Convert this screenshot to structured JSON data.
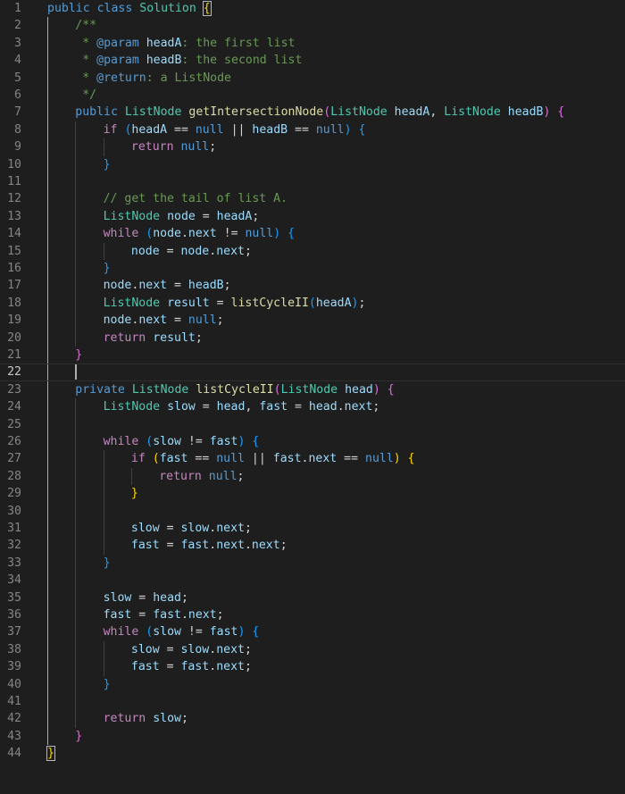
{
  "editor": {
    "active_line": 22,
    "colors": {
      "background": "#1e1e1e",
      "keyword": "#569cd6",
      "control": "#c586c0",
      "type": "#4ec9b0",
      "function": "#dcdcaa",
      "variable": "#9cdcfe",
      "comment": "#6a9955",
      "text": "#d4d4d4",
      "line_number": "#858585",
      "scope_guide": "#c9b53a"
    },
    "lines": [
      {
        "n": "1",
        "indent": 0,
        "tokens": [
          [
            "kw",
            "public"
          ],
          [
            "p",
            " "
          ],
          [
            "kw",
            "class"
          ],
          [
            "p",
            " "
          ],
          [
            "type",
            "Solution"
          ],
          [
            "p",
            " "
          ],
          [
            "b1",
            "{"
          ]
        ]
      },
      {
        "n": "2",
        "indent": 1,
        "tokens": [
          [
            "cm",
            "/**"
          ]
        ]
      },
      {
        "n": "3",
        "indent": 1,
        "tokens": [
          [
            "cm",
            " * "
          ],
          [
            "kw",
            "@param"
          ],
          [
            "cm",
            " "
          ],
          [
            "var",
            "headA"
          ],
          [
            "cm",
            ": the first list"
          ]
        ]
      },
      {
        "n": "4",
        "indent": 1,
        "tokens": [
          [
            "cm",
            " * "
          ],
          [
            "kw",
            "@param"
          ],
          [
            "cm",
            " "
          ],
          [
            "var",
            "headB"
          ],
          [
            "cm",
            ": the second list"
          ]
        ]
      },
      {
        "n": "5",
        "indent": 1,
        "tokens": [
          [
            "cm",
            " * "
          ],
          [
            "kw",
            "@return"
          ],
          [
            "cm",
            ": a ListNode"
          ]
        ]
      },
      {
        "n": "6",
        "indent": 1,
        "tokens": [
          [
            "cm",
            " */"
          ]
        ]
      },
      {
        "n": "7",
        "indent": 1,
        "tokens": [
          [
            "kw",
            "public"
          ],
          [
            "p",
            " "
          ],
          [
            "type",
            "ListNode"
          ],
          [
            "p",
            " "
          ],
          [
            "fn",
            "getIntersectionNode"
          ],
          [
            "b2",
            "("
          ],
          [
            "type",
            "ListNode"
          ],
          [
            "p",
            " "
          ],
          [
            "var",
            "headA"
          ],
          [
            "p",
            ", "
          ],
          [
            "type",
            "ListNode"
          ],
          [
            "p",
            " "
          ],
          [
            "var",
            "headB"
          ],
          [
            "b2",
            ")"
          ],
          [
            "p",
            " "
          ],
          [
            "b2",
            "{"
          ]
        ]
      },
      {
        "n": "8",
        "indent": 2,
        "tokens": [
          [
            "ctrl",
            "if"
          ],
          [
            "p",
            " "
          ],
          [
            "b3",
            "("
          ],
          [
            "var",
            "headA"
          ],
          [
            "p",
            " == "
          ],
          [
            "null",
            "null"
          ],
          [
            "p",
            " || "
          ],
          [
            "var",
            "headB"
          ],
          [
            "p",
            " == "
          ],
          [
            "null",
            "null"
          ],
          [
            "b3",
            ")"
          ],
          [
            "p",
            " "
          ],
          [
            "b3",
            "{"
          ]
        ]
      },
      {
        "n": "9",
        "indent": 3,
        "tokens": [
          [
            "ctrl",
            "return"
          ],
          [
            "p",
            " "
          ],
          [
            "null",
            "null"
          ],
          [
            "p",
            ";"
          ]
        ]
      },
      {
        "n": "10",
        "indent": 2,
        "tokens": [
          [
            "b3",
            "}"
          ]
        ]
      },
      {
        "n": "11",
        "indent": 2,
        "tokens": []
      },
      {
        "n": "12",
        "indent": 2,
        "tokens": [
          [
            "cm",
            "// get the tail of list A."
          ]
        ]
      },
      {
        "n": "13",
        "indent": 2,
        "tokens": [
          [
            "type",
            "ListNode"
          ],
          [
            "p",
            " "
          ],
          [
            "var",
            "node"
          ],
          [
            "p",
            " = "
          ],
          [
            "var",
            "headA"
          ],
          [
            "p",
            ";"
          ]
        ]
      },
      {
        "n": "14",
        "indent": 2,
        "tokens": [
          [
            "ctrl",
            "while"
          ],
          [
            "p",
            " "
          ],
          [
            "b3",
            "("
          ],
          [
            "var",
            "node"
          ],
          [
            "p",
            "."
          ],
          [
            "prop",
            "next"
          ],
          [
            "p",
            " != "
          ],
          [
            "null",
            "null"
          ],
          [
            "b3",
            ")"
          ],
          [
            "p",
            " "
          ],
          [
            "b3",
            "{"
          ]
        ]
      },
      {
        "n": "15",
        "indent": 3,
        "tokens": [
          [
            "var",
            "node"
          ],
          [
            "p",
            " = "
          ],
          [
            "var",
            "node"
          ],
          [
            "p",
            "."
          ],
          [
            "prop",
            "next"
          ],
          [
            "p",
            ";"
          ]
        ]
      },
      {
        "n": "16",
        "indent": 2,
        "tokens": [
          [
            "b3",
            "}"
          ]
        ]
      },
      {
        "n": "17",
        "indent": 2,
        "tokens": [
          [
            "var",
            "node"
          ],
          [
            "p",
            "."
          ],
          [
            "prop",
            "next"
          ],
          [
            "p",
            " = "
          ],
          [
            "var",
            "headB"
          ],
          [
            "p",
            ";"
          ]
        ]
      },
      {
        "n": "18",
        "indent": 2,
        "tokens": [
          [
            "type",
            "ListNode"
          ],
          [
            "p",
            " "
          ],
          [
            "var",
            "result"
          ],
          [
            "p",
            " = "
          ],
          [
            "fn",
            "listCycleII"
          ],
          [
            "b3",
            "("
          ],
          [
            "var",
            "headA"
          ],
          [
            "b3",
            ")"
          ],
          [
            "p",
            ";"
          ]
        ]
      },
      {
        "n": "19",
        "indent": 2,
        "tokens": [
          [
            "var",
            "node"
          ],
          [
            "p",
            "."
          ],
          [
            "prop",
            "next"
          ],
          [
            "p",
            " = "
          ],
          [
            "null",
            "null"
          ],
          [
            "p",
            ";"
          ]
        ]
      },
      {
        "n": "20",
        "indent": 2,
        "tokens": [
          [
            "ctrl",
            "return"
          ],
          [
            "p",
            " "
          ],
          [
            "var",
            "result"
          ],
          [
            "p",
            ";"
          ]
        ]
      },
      {
        "n": "21",
        "indent": 1,
        "tokens": [
          [
            "b2",
            "}"
          ]
        ]
      },
      {
        "n": "22",
        "indent": 1,
        "tokens": []
      },
      {
        "n": "23",
        "indent": 1,
        "tokens": [
          [
            "kw",
            "private"
          ],
          [
            "p",
            " "
          ],
          [
            "type",
            "ListNode"
          ],
          [
            "p",
            " "
          ],
          [
            "fn",
            "listCycleII"
          ],
          [
            "b2",
            "("
          ],
          [
            "type",
            "ListNode"
          ],
          [
            "p",
            " "
          ],
          [
            "var",
            "head"
          ],
          [
            "b2",
            ")"
          ],
          [
            "p",
            " "
          ],
          [
            "b2",
            "{"
          ]
        ]
      },
      {
        "n": "24",
        "indent": 2,
        "tokens": [
          [
            "type",
            "ListNode"
          ],
          [
            "p",
            " "
          ],
          [
            "var",
            "slow"
          ],
          [
            "p",
            " = "
          ],
          [
            "var",
            "head"
          ],
          [
            "p",
            ", "
          ],
          [
            "var",
            "fast"
          ],
          [
            "p",
            " = "
          ],
          [
            "var",
            "head"
          ],
          [
            "p",
            "."
          ],
          [
            "prop",
            "next"
          ],
          [
            "p",
            ";"
          ]
        ]
      },
      {
        "n": "25",
        "indent": 2,
        "tokens": []
      },
      {
        "n": "26",
        "indent": 2,
        "tokens": [
          [
            "ctrl",
            "while"
          ],
          [
            "p",
            " "
          ],
          [
            "b3",
            "("
          ],
          [
            "var",
            "slow"
          ],
          [
            "p",
            " != "
          ],
          [
            "var",
            "fast"
          ],
          [
            "b3",
            ")"
          ],
          [
            "p",
            " "
          ],
          [
            "b3",
            "{"
          ]
        ]
      },
      {
        "n": "27",
        "indent": 3,
        "tokens": [
          [
            "ctrl",
            "if"
          ],
          [
            "p",
            " "
          ],
          [
            "b1",
            "("
          ],
          [
            "var",
            "fast"
          ],
          [
            "p",
            " == "
          ],
          [
            "null",
            "null"
          ],
          [
            "p",
            " || "
          ],
          [
            "var",
            "fast"
          ],
          [
            "p",
            "."
          ],
          [
            "prop",
            "next"
          ],
          [
            "p",
            " == "
          ],
          [
            "null",
            "null"
          ],
          [
            "b1",
            ")"
          ],
          [
            "p",
            " "
          ],
          [
            "b1",
            "{"
          ]
        ]
      },
      {
        "n": "28",
        "indent": 4,
        "tokens": [
          [
            "ctrl",
            "return"
          ],
          [
            "p",
            " "
          ],
          [
            "null",
            "null"
          ],
          [
            "p",
            ";"
          ]
        ]
      },
      {
        "n": "29",
        "indent": 3,
        "tokens": [
          [
            "b1",
            "}"
          ]
        ]
      },
      {
        "n": "30",
        "indent": 3,
        "tokens": []
      },
      {
        "n": "31",
        "indent": 3,
        "tokens": [
          [
            "var",
            "slow"
          ],
          [
            "p",
            " = "
          ],
          [
            "var",
            "slow"
          ],
          [
            "p",
            "."
          ],
          [
            "prop",
            "next"
          ],
          [
            "p",
            ";"
          ]
        ]
      },
      {
        "n": "32",
        "indent": 3,
        "tokens": [
          [
            "var",
            "fast"
          ],
          [
            "p",
            " = "
          ],
          [
            "var",
            "fast"
          ],
          [
            "p",
            "."
          ],
          [
            "prop",
            "next"
          ],
          [
            "p",
            "."
          ],
          [
            "prop",
            "next"
          ],
          [
            "p",
            ";"
          ]
        ]
      },
      {
        "n": "33",
        "indent": 2,
        "tokens": [
          [
            "b3",
            "}"
          ]
        ]
      },
      {
        "n": "34",
        "indent": 2,
        "tokens": []
      },
      {
        "n": "35",
        "indent": 2,
        "tokens": [
          [
            "var",
            "slow"
          ],
          [
            "p",
            " = "
          ],
          [
            "var",
            "head"
          ],
          [
            "p",
            ";"
          ]
        ]
      },
      {
        "n": "36",
        "indent": 2,
        "tokens": [
          [
            "var",
            "fast"
          ],
          [
            "p",
            " = "
          ],
          [
            "var",
            "fast"
          ],
          [
            "p",
            "."
          ],
          [
            "prop",
            "next"
          ],
          [
            "p",
            ";"
          ]
        ]
      },
      {
        "n": "37",
        "indent": 2,
        "tokens": [
          [
            "ctrl",
            "while"
          ],
          [
            "p",
            " "
          ],
          [
            "b3",
            "("
          ],
          [
            "var",
            "slow"
          ],
          [
            "p",
            " != "
          ],
          [
            "var",
            "fast"
          ],
          [
            "b3",
            ")"
          ],
          [
            "p",
            " "
          ],
          [
            "b3",
            "{"
          ]
        ]
      },
      {
        "n": "38",
        "indent": 3,
        "tokens": [
          [
            "var",
            "slow"
          ],
          [
            "p",
            " = "
          ],
          [
            "var",
            "slow"
          ],
          [
            "p",
            "."
          ],
          [
            "prop",
            "next"
          ],
          [
            "p",
            ";"
          ]
        ]
      },
      {
        "n": "39",
        "indent": 3,
        "tokens": [
          [
            "var",
            "fast"
          ],
          [
            "p",
            " = "
          ],
          [
            "var",
            "fast"
          ],
          [
            "p",
            "."
          ],
          [
            "prop",
            "next"
          ],
          [
            "p",
            ";"
          ]
        ]
      },
      {
        "n": "40",
        "indent": 2,
        "tokens": [
          [
            "b3",
            "}"
          ]
        ]
      },
      {
        "n": "41",
        "indent": 2,
        "tokens": []
      },
      {
        "n": "42",
        "indent": 2,
        "tokens": [
          [
            "ctrl",
            "return"
          ],
          [
            "p",
            " "
          ],
          [
            "var",
            "slow"
          ],
          [
            "p",
            ";"
          ]
        ]
      },
      {
        "n": "43",
        "indent": 1,
        "tokens": [
          [
            "b2",
            "}"
          ]
        ]
      },
      {
        "n": "44",
        "indent": 0,
        "tokens": [
          [
            "b1",
            "}"
          ]
        ]
      }
    ]
  }
}
